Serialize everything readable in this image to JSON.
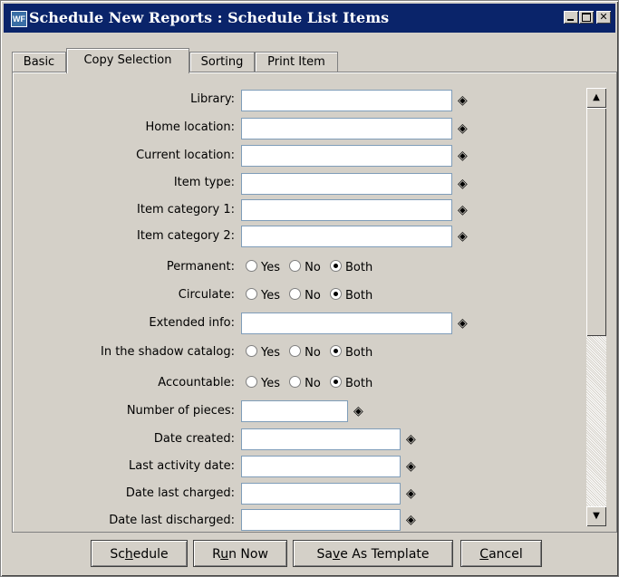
{
  "window": {
    "app_icon": "WF",
    "title": "Schedule New Reports : Schedule List Items"
  },
  "tabs": [
    {
      "label": "Basic"
    },
    {
      "label": "Copy Selection"
    },
    {
      "label": "Sorting"
    },
    {
      "label": "Print Item"
    }
  ],
  "form": {
    "library": {
      "label": "Library:",
      "value": ""
    },
    "home_location": {
      "label": "Home location:",
      "value": ""
    },
    "current_location": {
      "label": "Current location:",
      "value": ""
    },
    "item_type": {
      "label": "Item type:",
      "value": ""
    },
    "item_category_1": {
      "label": "Item category 1:",
      "value": ""
    },
    "item_category_2": {
      "label": "Item category 2:",
      "value": ""
    },
    "permanent": {
      "label": "Permanent:",
      "options": [
        "Yes",
        "No",
        "Both"
      ],
      "selected": "Both"
    },
    "circulate": {
      "label": "Circulate:",
      "options": [
        "Yes",
        "No",
        "Both"
      ],
      "selected": "Both"
    },
    "extended_info": {
      "label": "Extended info:",
      "value": ""
    },
    "shadow_catalog": {
      "label": "In the shadow catalog:",
      "options": [
        "Yes",
        "No",
        "Both"
      ],
      "selected": "Both"
    },
    "accountable": {
      "label": "Accountable:",
      "options": [
        "Yes",
        "No",
        "Both"
      ],
      "selected": "Both"
    },
    "number_of_pieces": {
      "label": "Number of pieces:",
      "value": ""
    },
    "date_created": {
      "label": "Date created:",
      "value": ""
    },
    "last_activity_date": {
      "label": "Last activity date:",
      "value": ""
    },
    "date_last_charged": {
      "label": "Date last charged:",
      "value": ""
    },
    "date_last_discharged": {
      "label": "Date last discharged:",
      "value": ""
    }
  },
  "buttons": {
    "schedule": {
      "pre": "Sc",
      "key": "h",
      "post": "edule"
    },
    "run_now": {
      "pre": "R",
      "key": "u",
      "post": "n Now"
    },
    "save_template": {
      "pre": "Sa",
      "key": "v",
      "post": "e As Template"
    },
    "cancel": {
      "pre": "",
      "key": "C",
      "post": "ancel"
    }
  },
  "icons": {
    "lookup": "gallery-diamond-icon",
    "scroll_up": "arrow-up-icon",
    "scroll_down": "arrow-down-icon"
  }
}
